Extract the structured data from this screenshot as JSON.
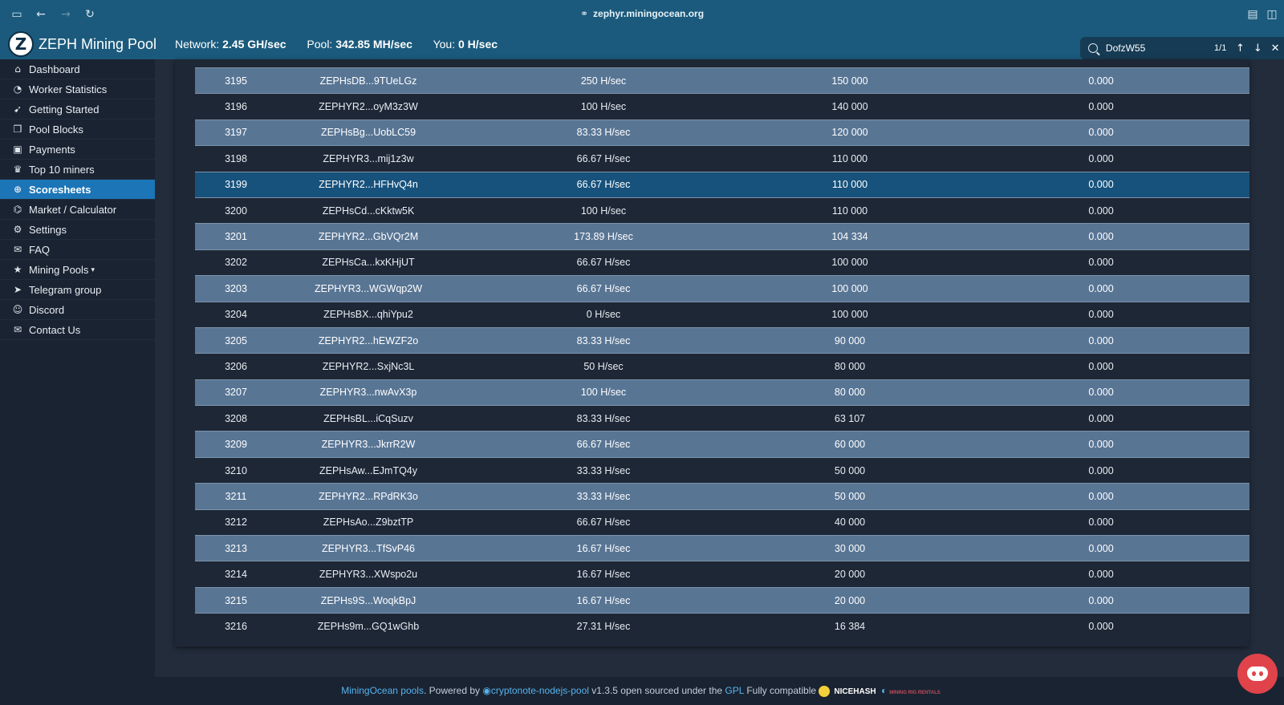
{
  "browser": {
    "url": "zephyr.miningocean.org"
  },
  "header": {
    "title": "ZEPH Mining Pool",
    "logo_letter": "Z",
    "network_label": "Network:",
    "network_value": "2.45 GH/sec",
    "pool_label": "Pool:",
    "pool_value": "342.85 MH/sec",
    "you_label": "You:",
    "you_value": "0 H/sec"
  },
  "find": {
    "query": "DofzW55",
    "count": "1/1"
  },
  "sidebar": {
    "items": [
      {
        "label": "Dashboard",
        "icon": "home-icon"
      },
      {
        "label": "Worker Statistics",
        "icon": "dashboard-icon"
      },
      {
        "label": "Getting Started",
        "icon": "rocket-icon"
      },
      {
        "label": "Pool Blocks",
        "icon": "cubes-icon"
      },
      {
        "label": "Payments",
        "icon": "money-icon"
      },
      {
        "label": "Top 10 miners",
        "icon": "trophy-icon"
      },
      {
        "label": "Scoresheets",
        "icon": "support-icon"
      },
      {
        "label": "Market / Calculator",
        "icon": "bank-icon"
      },
      {
        "label": "Settings",
        "icon": "cogs-icon"
      },
      {
        "label": "FAQ",
        "icon": "comments-icon"
      },
      {
        "label": "Mining Pools",
        "icon": "star-icon"
      },
      {
        "label": "Telegram group",
        "icon": "telegram-icon"
      },
      {
        "label": "Discord",
        "icon": "discord-icon"
      },
      {
        "label": "Contact Us",
        "icon": "envelope-icon"
      }
    ],
    "active": "Scoresheets"
  },
  "table": {
    "rows": [
      [
        "3195",
        "ZEPHsDB...9TUeLGz",
        "250 H/sec",
        "150 000",
        "0.000"
      ],
      [
        "3196",
        "ZEPHYR2...oyM3z3W",
        "100 H/sec",
        "140 000",
        "0.000"
      ],
      [
        "3197",
        "ZEPHsBg...UobLC59",
        "83.33 H/sec",
        "120 000",
        "0.000"
      ],
      [
        "3198",
        "ZEPHYR3...mij1z3w",
        "66.67 H/sec",
        "110 000",
        "0.000"
      ],
      [
        "3199",
        "ZEPHYR2...HFHvQ4n",
        "66.67 H/sec",
        "110 000",
        "0.000"
      ],
      [
        "3200",
        "ZEPHsCd...cKktw5K",
        "100 H/sec",
        "110 000",
        "0.000"
      ],
      [
        "3201",
        "ZEPHYR2...GbVQr2M",
        "173.89 H/sec",
        "104 334",
        "0.000"
      ],
      [
        "3202",
        "ZEPHsCa...kxKHjUT",
        "66.67 H/sec",
        "100 000",
        "0.000"
      ],
      [
        "3203",
        "ZEPHYR3...WGWqp2W",
        "66.67 H/sec",
        "100 000",
        "0.000"
      ],
      [
        "3204",
        "ZEPHsBX...qhiYpu2",
        "0 H/sec",
        "100 000",
        "0.000"
      ],
      [
        "3205",
        "ZEPHYR2...hEWZF2o",
        "83.33 H/sec",
        "90 000",
        "0.000"
      ],
      [
        "3206",
        "ZEPHYR2...SxjNc3L",
        "50 H/sec",
        "80 000",
        "0.000"
      ],
      [
        "3207",
        "ZEPHYR3...nwAvX3p",
        "100 H/sec",
        "80 000",
        "0.000"
      ],
      [
        "3208",
        "ZEPHsBL...iCqSuzv",
        "83.33 H/sec",
        "63 107",
        "0.000"
      ],
      [
        "3209",
        "ZEPHYR3...JkrrR2W",
        "66.67 H/sec",
        "60 000",
        "0.000"
      ],
      [
        "3210",
        "ZEPHsAw...EJmTQ4y",
        "33.33 H/sec",
        "50 000",
        "0.000"
      ],
      [
        "3211",
        "ZEPHYR2...RPdRK3o",
        "33.33 H/sec",
        "50 000",
        "0.000"
      ],
      [
        "3212",
        "ZEPHsAo...Z9bztTP",
        "66.67 H/sec",
        "40 000",
        "0.000"
      ],
      [
        "3213",
        "ZEPHYR3...TfSvP46",
        "16.67 H/sec",
        "30 000",
        "0.000"
      ],
      [
        "3214",
        "ZEPHYR3...XWspo2u",
        "16.67 H/sec",
        "20 000",
        "0.000"
      ],
      [
        "3215",
        "ZEPHs9S...WoqkBpJ",
        "16.67 H/sec",
        "20 000",
        "0.000"
      ],
      [
        "3216",
        "ZEPHs9m...GQ1wGhb",
        "27.31 H/sec",
        "16 384",
        "0.000"
      ]
    ],
    "highlighted_row": "3199"
  },
  "footer": {
    "pools_link": "MiningOcean pools",
    "powered_by": ". Powered by",
    "engine_link": "cryptonote-nodejs-pool",
    "version_text": "v1.3.5 open sourced under the",
    "license_link": "GPL",
    "compat_text": "Fully compatible",
    "nicehash": "NICEHASH",
    "mrr": "MINING RIG RENTALS"
  },
  "colors": {
    "brand_bar": "#1b5a7c",
    "active_item": "#1c75b7",
    "row_odd": "#587594",
    "row_even": "#1e2736",
    "row_highlight": "#17527c",
    "link": "#56b3ef",
    "discord_fab": "#e0434a"
  }
}
